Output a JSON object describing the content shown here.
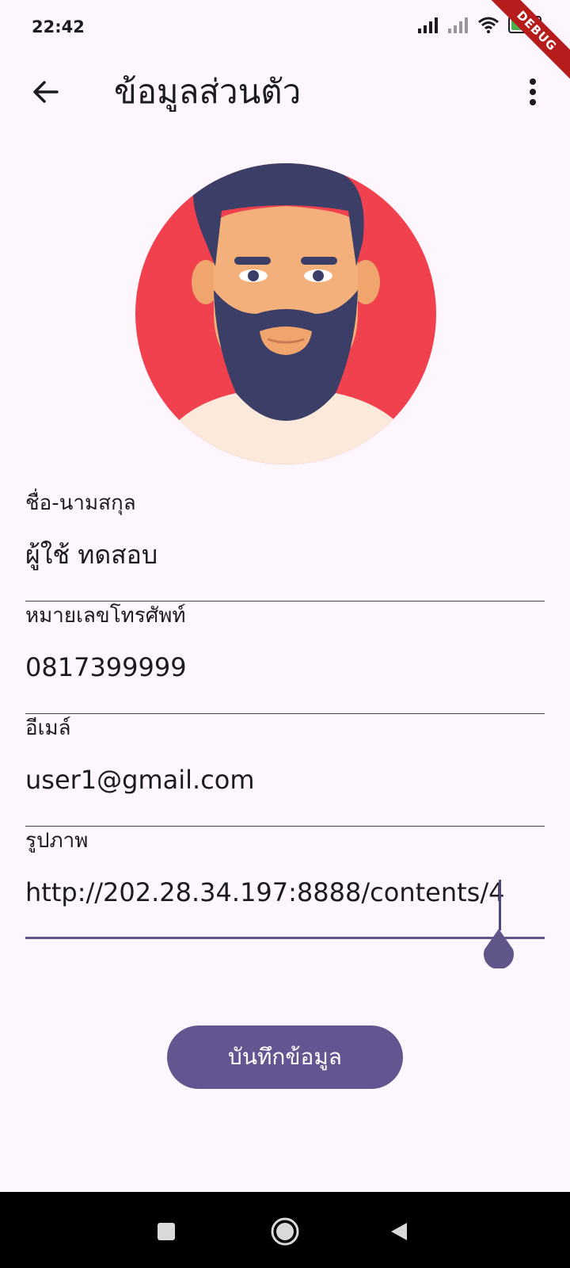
{
  "status_bar": {
    "time": "22:42",
    "battery_level": "42",
    "debug_label": "DEBUG"
  },
  "app_bar": {
    "title": "ข้อมูลส่วนตัว"
  },
  "form": {
    "name": {
      "label": "ชื่อ-นามสกุล",
      "value": "ผู้ใช้ ทดสอบ"
    },
    "phone": {
      "label": "หมายเลขโทรศัพท์",
      "value": "0817399999"
    },
    "email": {
      "label": "อีเมล์",
      "value": "user1@gmail.com"
    },
    "image": {
      "label": "รูปภาพ",
      "value": "http://202.28.34.197:8888/contents/4"
    }
  },
  "save_button": {
    "label": "บันทึกข้อมูล"
  },
  "colors": {
    "accent": "#645490",
    "background": "#fdf7fd",
    "avatar_circle": "#f2414e",
    "hair": "#3b3e66",
    "skin": "#f4b07a"
  }
}
